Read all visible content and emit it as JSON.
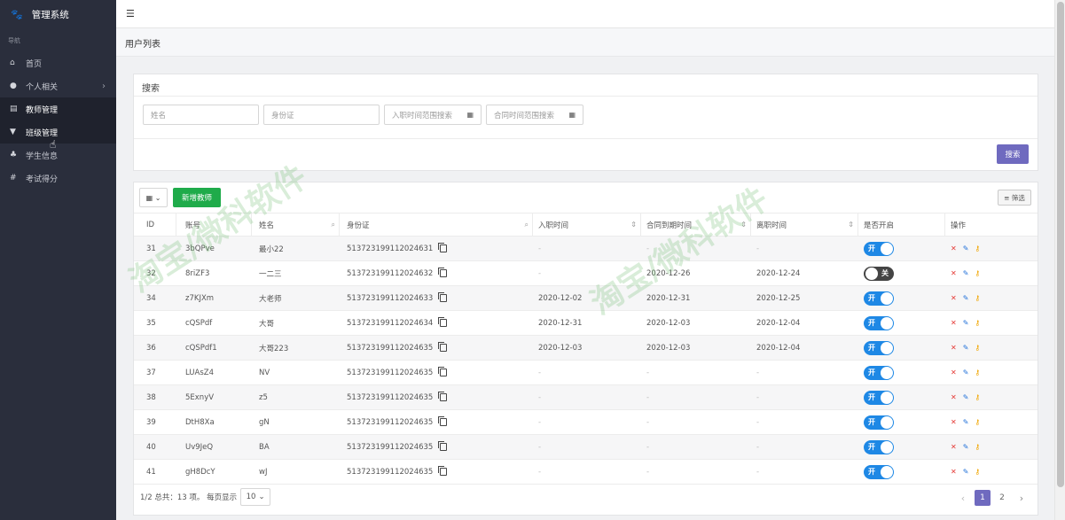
{
  "app": {
    "title": "管理系统"
  },
  "sidebar": {
    "caption": "导航",
    "items": [
      {
        "label": "首页",
        "icon": "home-icon"
      },
      {
        "label": "个人相关",
        "icon": "user-icon",
        "has_children": true
      },
      {
        "label": "教师管理",
        "icon": "list-icon",
        "active": true
      },
      {
        "label": "班级管理",
        "icon": "filter-icon",
        "active": true
      },
      {
        "label": "学生信息",
        "icon": "users-icon"
      },
      {
        "label": "考试得分",
        "icon": "hash-icon"
      }
    ]
  },
  "page": {
    "title": "用户列表"
  },
  "search": {
    "title": "搜索",
    "name_placeholder": "姓名",
    "idcard_placeholder": "身份证",
    "join_range_placeholder": "入职时间范围搜索",
    "contract_range_placeholder": "合同时间范围搜索",
    "button": "搜索"
  },
  "toolbar": {
    "add_label": "新增教师",
    "filter_label": "筛选"
  },
  "table": {
    "headers": {
      "id": "ID",
      "account": "账号",
      "name": "姓名",
      "idcard": "身份证",
      "join": "入职时间",
      "contract": "合同到期时间",
      "leave": "离职时间",
      "open": "是否开启",
      "ops": "操作"
    },
    "rows": [
      {
        "id": "31",
        "account": "3bQPve",
        "name": "最小22",
        "idcard": "513723199112024631",
        "join": "-",
        "contract": "-",
        "leave": "-",
        "open": "开",
        "enabled": true
      },
      {
        "id": "32",
        "account": "8riZF3",
        "name": "一二三",
        "idcard": "513723199112024632",
        "join": "-",
        "contract": "2020-12-26",
        "leave": "2020-12-24",
        "open": "关",
        "enabled": false
      },
      {
        "id": "34",
        "account": "z7KJXm",
        "name": "大老师",
        "idcard": "513723199112024633",
        "join": "2020-12-02",
        "contract": "2020-12-31",
        "leave": "2020-12-25",
        "open": "开",
        "enabled": true
      },
      {
        "id": "35",
        "account": "cQSPdf",
        "name": "大哥",
        "idcard": "513723199112024634",
        "join": "2020-12-31",
        "contract": "2020-12-03",
        "leave": "2020-12-04",
        "open": "开",
        "enabled": true
      },
      {
        "id": "36",
        "account": "cQSPdf1",
        "name": "大哥223",
        "idcard": "513723199112024635",
        "join": "2020-12-03",
        "contract": "2020-12-03",
        "leave": "2020-12-04",
        "open": "开",
        "enabled": true
      },
      {
        "id": "37",
        "account": "LUAsZ4",
        "name": "NV",
        "idcard": "513723199112024635",
        "join": "-",
        "contract": "-",
        "leave": "-",
        "open": "开",
        "enabled": true
      },
      {
        "id": "38",
        "account": "5ExnyV",
        "name": "z5",
        "idcard": "513723199112024635",
        "join": "-",
        "contract": "-",
        "leave": "-",
        "open": "开",
        "enabled": true
      },
      {
        "id": "39",
        "account": "DtH8Xa",
        "name": "gN",
        "idcard": "513723199112024635",
        "join": "-",
        "contract": "-",
        "leave": "-",
        "open": "开",
        "enabled": true
      },
      {
        "id": "40",
        "account": "Uv9JeQ",
        "name": "BA",
        "idcard": "513723199112024635",
        "join": "-",
        "contract": "-",
        "leave": "-",
        "open": "开",
        "enabled": true
      },
      {
        "id": "41",
        "account": "gH8DcY",
        "name": "wJ",
        "idcard": "513723199112024635",
        "join": "-",
        "contract": "-",
        "leave": "-",
        "open": "开",
        "enabled": true
      }
    ]
  },
  "footer": {
    "summary": "1/2 总共：13 项。 每页显示",
    "page_size": "10"
  },
  "pagination": {
    "pages": [
      "1",
      "2"
    ],
    "current": "1"
  },
  "watermark": {
    "text": "淘宝/微科软件"
  },
  "colors": {
    "sidebar": "#2a2e3c",
    "primary": "#6f6abf",
    "add_button": "#1fab4a",
    "toggle_on": "#1e88e5"
  }
}
